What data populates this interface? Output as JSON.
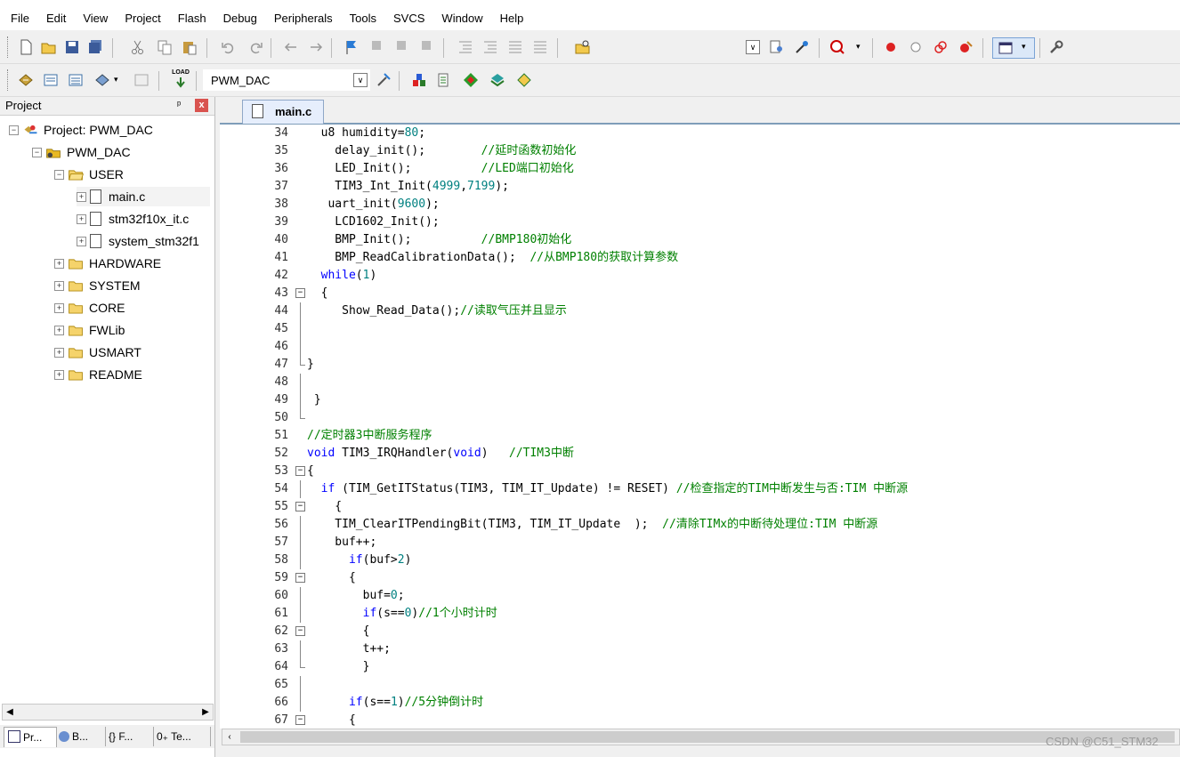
{
  "menu": [
    "File",
    "Edit",
    "View",
    "Project",
    "Flash",
    "Debug",
    "Peripherals",
    "Tools",
    "SVCS",
    "Window",
    "Help"
  ],
  "toolbar2": {
    "target_name": "PWM_DAC",
    "load_label": "LOAD"
  },
  "project_panel": {
    "title": "Project",
    "pin": "ᵖ",
    "close": "x",
    "tree": [
      {
        "label": "Project: PWM_DAC",
        "kind": "project",
        "expander": "−"
      },
      {
        "label": "PWM_DAC",
        "kind": "target",
        "expander": "−"
      },
      {
        "label": "USER",
        "kind": "folder-open",
        "expander": "−"
      },
      {
        "label": "main.c",
        "kind": "file",
        "expander": "+"
      },
      {
        "label": "stm32f10x_it.c",
        "kind": "file",
        "expander": "+"
      },
      {
        "label": "system_stm32f1",
        "kind": "file",
        "expander": "+"
      },
      {
        "label": "HARDWARE",
        "kind": "folder",
        "expander": "+"
      },
      {
        "label": "SYSTEM",
        "kind": "folder",
        "expander": "+"
      },
      {
        "label": "CORE",
        "kind": "folder",
        "expander": "+"
      },
      {
        "label": "FWLib",
        "kind": "folder",
        "expander": "+"
      },
      {
        "label": "USMART",
        "kind": "folder",
        "expander": "+"
      },
      {
        "label": "README",
        "kind": "folder",
        "expander": "+"
      }
    ],
    "bottom_tabs": [
      "Pr...",
      "B...",
      "{} F...",
      "0₊ Te..."
    ]
  },
  "editor": {
    "tab_label": "main.c",
    "lines": [
      {
        "n": "34",
        "fold": "",
        "parts": [
          [
            "",
            "  u8 humidity="
          ],
          [
            "num",
            "80"
          ],
          [
            "",
            ";"
          ]
        ]
      },
      {
        "n": "35",
        "fold": "",
        "parts": [
          [
            "",
            "    delay_init();        "
          ],
          [
            "cmt",
            "//延时函数初始化"
          ]
        ]
      },
      {
        "n": "36",
        "fold": "",
        "parts": [
          [
            "",
            "    LED_Init();          "
          ],
          [
            "cmt",
            "//LED端口初始化"
          ]
        ]
      },
      {
        "n": "37",
        "fold": "",
        "parts": [
          [
            "",
            "    TIM3_Int_Init("
          ],
          [
            "num",
            "4999"
          ],
          [
            "",
            ","
          ],
          [
            "num",
            "7199"
          ],
          [
            "",
            ");"
          ]
        ]
      },
      {
        "n": "38",
        "fold": "",
        "parts": [
          [
            "",
            "   uart_init("
          ],
          [
            "num",
            "9600"
          ],
          [
            "",
            ");"
          ]
        ]
      },
      {
        "n": "39",
        "fold": "",
        "parts": [
          [
            "",
            "    LCD1602_Init();"
          ]
        ]
      },
      {
        "n": "40",
        "fold": "",
        "parts": [
          [
            "",
            "    BMP_Init();          "
          ],
          [
            "cmt",
            "//BMP180初始化"
          ]
        ]
      },
      {
        "n": "41",
        "fold": "",
        "parts": [
          [
            "",
            "    BMP_ReadCalibrationData();  "
          ],
          [
            "cmt",
            "//从BMP180的获取计算参数"
          ]
        ]
      },
      {
        "n": "42",
        "fold": "",
        "parts": [
          [
            "kw",
            "  while"
          ],
          [
            "",
            "("
          ],
          [
            "num",
            "1"
          ],
          [
            "",
            ")"
          ]
        ]
      },
      {
        "n": "43",
        "fold": "open",
        "parts": [
          [
            "",
            "  {"
          ]
        ]
      },
      {
        "n": "44",
        "fold": "line",
        "parts": [
          [
            "",
            "     Show_Read_Data();"
          ],
          [
            "cmt",
            "//读取气压并且显示"
          ]
        ]
      },
      {
        "n": "45",
        "fold": "line",
        "parts": [
          [
            "",
            ""
          ]
        ]
      },
      {
        "n": "46",
        "fold": "line",
        "parts": [
          [
            "",
            ""
          ]
        ]
      },
      {
        "n": "47",
        "fold": "end",
        "parts": [
          [
            "",
            "}"
          ]
        ]
      },
      {
        "n": "48",
        "fold": "line",
        "parts": [
          [
            "",
            ""
          ]
        ]
      },
      {
        "n": "49",
        "fold": "line",
        "parts": [
          [
            "",
            " }"
          ]
        ]
      },
      {
        "n": "50",
        "fold": "end",
        "parts": [
          [
            "",
            ""
          ]
        ]
      },
      {
        "n": "51",
        "fold": "",
        "parts": [
          [
            "cmt",
            "//定时器3中断服务程序"
          ]
        ]
      },
      {
        "n": "52",
        "fold": "",
        "parts": [
          [
            "kw",
            "void"
          ],
          [
            "",
            " TIM3_IRQHandler("
          ],
          [
            "kw",
            "void"
          ],
          [
            "",
            ")   "
          ],
          [
            "cmt",
            "//TIM3中断"
          ]
        ]
      },
      {
        "n": "53",
        "fold": "open",
        "parts": [
          [
            "",
            "{"
          ]
        ]
      },
      {
        "n": "54",
        "fold": "line",
        "parts": [
          [
            "kw",
            "  if"
          ],
          [
            "",
            " (TIM_GetITStatus(TIM3, TIM_IT_Update) != RESET) "
          ],
          [
            "cmt",
            "//检查指定的TIM中断发生与否:TIM 中断源"
          ]
        ]
      },
      {
        "n": "55",
        "fold": "open",
        "parts": [
          [
            "",
            "    {"
          ]
        ]
      },
      {
        "n": "56",
        "fold": "line",
        "parts": [
          [
            "",
            "    TIM_ClearITPendingBit(TIM3, TIM_IT_Update  );  "
          ],
          [
            "cmt",
            "//清除TIMx的中断待处理位:TIM 中断源"
          ]
        ]
      },
      {
        "n": "57",
        "fold": "line",
        "parts": [
          [
            "",
            "    buf++;"
          ]
        ]
      },
      {
        "n": "58",
        "fold": "line",
        "parts": [
          [
            "kw",
            "      if"
          ],
          [
            "",
            "(buf>"
          ],
          [
            "num",
            "2"
          ],
          [
            "",
            ")"
          ]
        ]
      },
      {
        "n": "59",
        "fold": "open",
        "parts": [
          [
            "",
            "      {"
          ]
        ]
      },
      {
        "n": "60",
        "fold": "line",
        "parts": [
          [
            "",
            "        buf="
          ],
          [
            "num",
            "0"
          ],
          [
            "",
            ";"
          ]
        ]
      },
      {
        "n": "61",
        "fold": "line",
        "parts": [
          [
            "kw",
            "        if"
          ],
          [
            "",
            "(s=="
          ],
          [
            "num",
            "0"
          ],
          [
            "",
            ")"
          ],
          [
            "cmt",
            "//1个小时计时"
          ]
        ]
      },
      {
        "n": "62",
        "fold": "open",
        "parts": [
          [
            "",
            "        {"
          ]
        ]
      },
      {
        "n": "63",
        "fold": "line",
        "parts": [
          [
            "",
            "        t++;"
          ]
        ]
      },
      {
        "n": "64",
        "fold": "end",
        "parts": [
          [
            "",
            "        }"
          ]
        ]
      },
      {
        "n": "65",
        "fold": "line",
        "parts": [
          [
            "",
            ""
          ]
        ]
      },
      {
        "n": "66",
        "fold": "line",
        "parts": [
          [
            "kw",
            "      if"
          ],
          [
            "",
            "(s=="
          ],
          [
            "num",
            "1"
          ],
          [
            "",
            ")"
          ],
          [
            "cmt",
            "//5分钟倒计时"
          ]
        ]
      },
      {
        "n": "67",
        "fold": "open",
        "parts": [
          [
            "",
            "      {"
          ]
        ]
      }
    ]
  },
  "watermark": "CSDN @C51_STM32"
}
